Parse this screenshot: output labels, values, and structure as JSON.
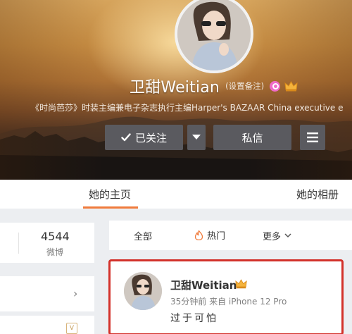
{
  "profile": {
    "name": "卫甜Weitian",
    "remark": "(设置备注)",
    "bio": "《时尚芭莎》时装主编兼电子杂志执行主编Harper's BAZAAR China executive e"
  },
  "actions": {
    "follow_label": "已关注",
    "message_label": "私信"
  },
  "tabs": {
    "home": "她的主页",
    "album": "她的相册"
  },
  "stats": {
    "weibo_count": "4544",
    "weibo_label": "微博"
  },
  "filters": {
    "all": "全部",
    "hot": "热门",
    "more": "更多"
  },
  "post": {
    "author": "卫甜Weitian",
    "meta": "35分钟前 来自 iPhone 12 Pro",
    "text": "过于可怕"
  },
  "colors": {
    "accent": "#f07b3c",
    "highlight_border": "#d3312a",
    "button_bg": "#5a5a5f"
  }
}
